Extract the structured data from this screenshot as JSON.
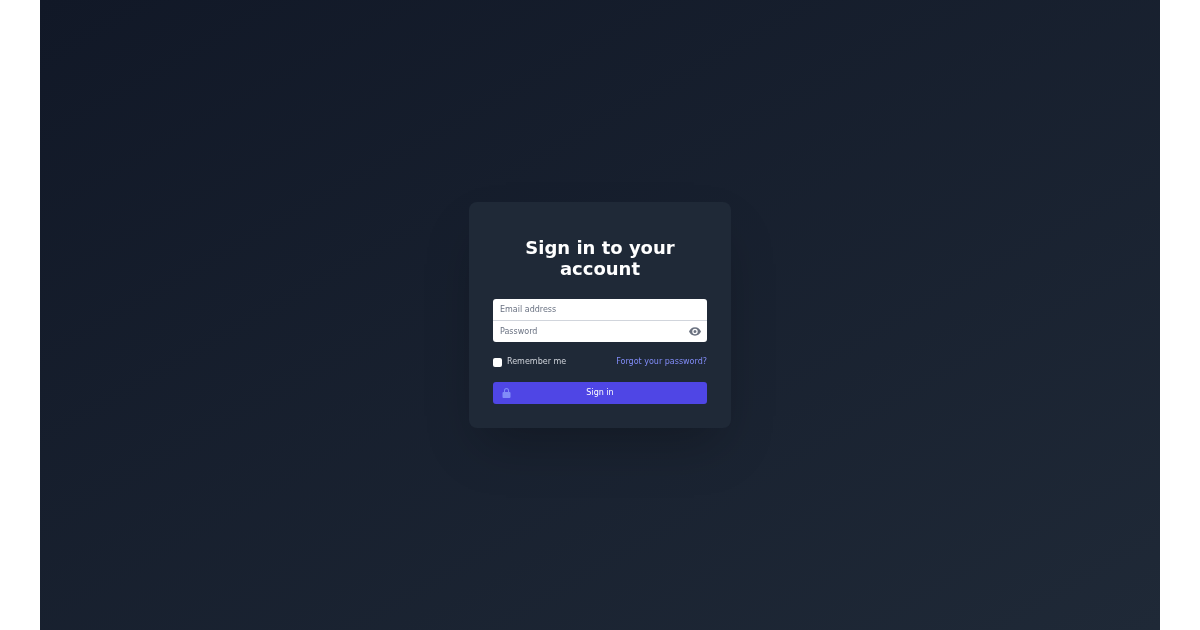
{
  "title": "Sign in to your account",
  "form": {
    "fields": [
      {
        "kind": "email",
        "placeholder": "Email address"
      },
      {
        "kind": "password",
        "placeholder": "Password"
      }
    ],
    "remember": {
      "label": "Remember me",
      "checked": false
    },
    "forgot_link": "Forgot your password?",
    "submit": "Sign in"
  }
}
